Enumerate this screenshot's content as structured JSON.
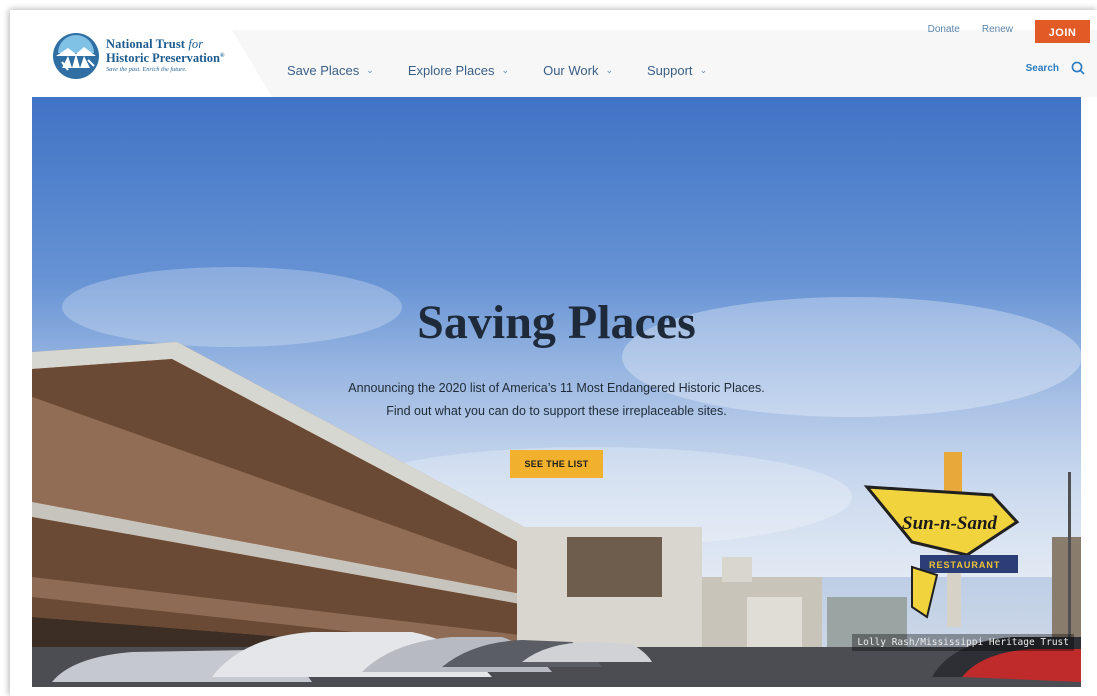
{
  "brand": {
    "line1": "National Trust",
    "line1_for": "for",
    "line2": "Historic Preservation",
    "line2_mark": "®",
    "tagline": "Save the past. Enrich the future.",
    "color": "#1d5c8f"
  },
  "utility": {
    "donate": "Donate",
    "renew": "Renew",
    "join": "JOIN",
    "join_color": "#e25a26"
  },
  "nav": {
    "items": [
      {
        "label": "Save Places"
      },
      {
        "label": "Explore Places"
      },
      {
        "label": "Our Work"
      },
      {
        "label": "Support"
      }
    ],
    "chevron": "⌄"
  },
  "search": {
    "label": "Search",
    "icon": "search-icon"
  },
  "hero": {
    "title": "Saving Places",
    "subtitle_line1": "Announcing the 2020 list of America’s 11 Most Endangered Historic Places.",
    "subtitle_line2": "Find out what you can do to support these irreplaceable sites.",
    "cta": "SEE THE LIST",
    "cta_color": "#f2b12c",
    "photo_credit": "Lolly Rash/Mississippi Heritage Trust",
    "sign_text": "Sun-n-Sand",
    "sign_subtext": "RESTAURANT"
  }
}
